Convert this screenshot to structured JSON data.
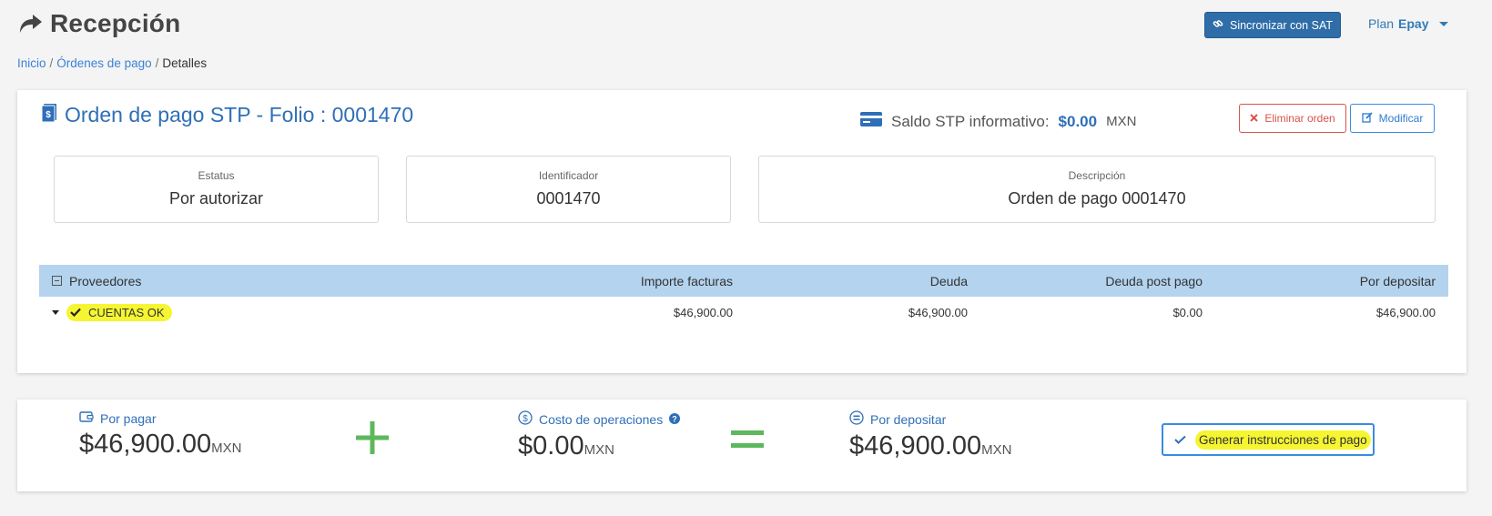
{
  "header": {
    "title": "Recepción",
    "sync_button": "Sincronizar con SAT",
    "plan_label": "Plan",
    "plan_name": "Epay"
  },
  "breadcrumb": {
    "items": [
      "Inicio",
      "Órdenes de pago",
      "Detalles"
    ]
  },
  "order": {
    "title": "Orden de pago STP - Folio : 0001470",
    "saldo_label": "Saldo STP informativo:",
    "saldo_amount": "$0.00",
    "saldo_currency": "MXN",
    "delete_button": "Eliminar orden",
    "modify_button": "Modificar"
  },
  "info": {
    "status_label": "Estatus",
    "status_value": "Por autorizar",
    "id_label": "Identificador",
    "id_value": "0001470",
    "desc_label": "Descripción",
    "desc_value": "Orden de pago 0001470"
  },
  "table": {
    "columns": [
      "Proveedores",
      "Importe facturas",
      "Deuda",
      "Deuda post pago",
      "Por depositar"
    ],
    "rows": [
      {
        "provider": "CUENTAS OK",
        "importe": "$46,900.00",
        "deuda": "$46,900.00",
        "deuda_post": "$0.00",
        "por_depositar": "$46,900.00"
      }
    ]
  },
  "summary": {
    "por_pagar_label": "Por pagar",
    "por_pagar_amount": "$46,900.00",
    "costo_label": "Costo de operaciones",
    "costo_amount": "$0.00",
    "por_depositar_label": "Por depositar",
    "por_depositar_amount": "$46,900.00",
    "currency": "MXN",
    "generate_button": "Generar instrucciones de pago"
  },
  "colors": {
    "primary": "#2f6fb8",
    "danger": "#d9534f",
    "highlight": "#f5f532",
    "table_header": "#b3d3ee",
    "operator_green": "#5cb85c"
  },
  "icons": [
    "share-arrow-icon",
    "link-icon",
    "dollar-document-icon",
    "credit-card-icon",
    "close-icon",
    "edit-icon",
    "collapse-icon",
    "caret-down-icon",
    "check-icon",
    "wallet-icon",
    "dollar-circle-icon",
    "question-icon",
    "equal-circle-icon",
    "plus-icon",
    "equals-icon"
  ]
}
